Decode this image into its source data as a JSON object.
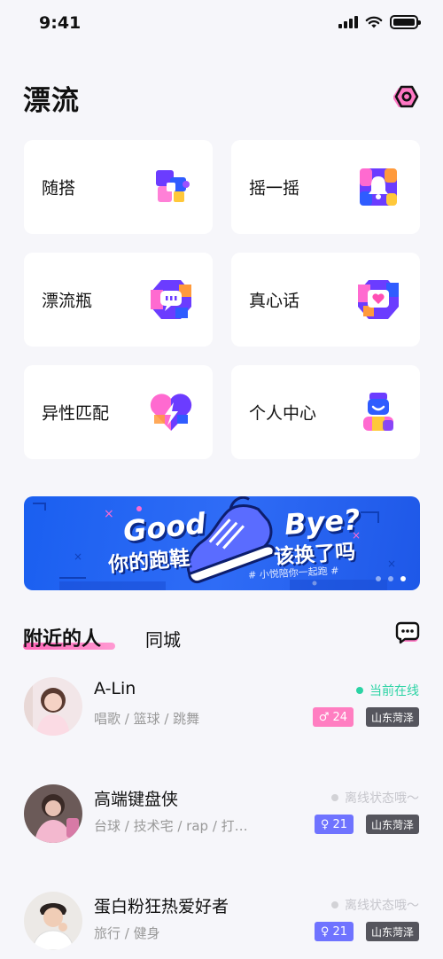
{
  "status_bar": {
    "time": "9:41",
    "signal_icon": "signal-icon",
    "wifi_icon": "wifi-icon",
    "battery_icon": "battery-icon"
  },
  "header": {
    "title": "漂流",
    "settings_icon": "settings-hexagon-icon"
  },
  "features": [
    {
      "label": "随搭",
      "icon": "puzzle-icon"
    },
    {
      "label": "摇一摇",
      "icon": "bell-icon"
    },
    {
      "label": "漂流瓶",
      "icon": "chat-bubble-icon"
    },
    {
      "label": "真心话",
      "icon": "heart-message-icon"
    },
    {
      "label": "异性匹配",
      "icon": "lightning-heart-icon"
    },
    {
      "label": "个人中心",
      "icon": "person-icon"
    }
  ],
  "banner": {
    "headline_left": "Good",
    "headline_right": "Bye?",
    "line_left": "你的跑鞋",
    "line_right": "该换了吗",
    "subtitle": "# 小悦陪你一起跑 #",
    "page_count": 3,
    "active_page": 3
  },
  "section": {
    "tab_active": "附近的人",
    "tab_other": "同城",
    "message_icon": "message-icon"
  },
  "users": [
    {
      "name": "A-Lin",
      "tags": "唱歌 / 篮球 / 跳舞",
      "status": "当前在线",
      "online": true,
      "gender_symbol": "♂",
      "age": "24",
      "gender_class": "male",
      "location": "山东菏泽"
    },
    {
      "name": "高端键盘侠",
      "tags": "台球 / 技术宅 / rap / 打…",
      "status": "离线状态哦～",
      "online": false,
      "gender_symbol": "♀",
      "age": "21",
      "gender_class": "female",
      "location": "山东菏泽"
    },
    {
      "name": "蛋白粉狂热爱好者",
      "tags": "旅行 / 健身",
      "status": "离线状态哦～",
      "online": false,
      "gender_symbol": "♀",
      "age": "21",
      "gender_class": "female",
      "location": "山东菏泽"
    }
  ],
  "colors": {
    "accent_pink": "#ff66b8",
    "online_green": "#2bd3a4",
    "banner_blue": "#2f6cf6",
    "female_badge": "#6f73ff",
    "male_badge": "#ff7ec1"
  }
}
